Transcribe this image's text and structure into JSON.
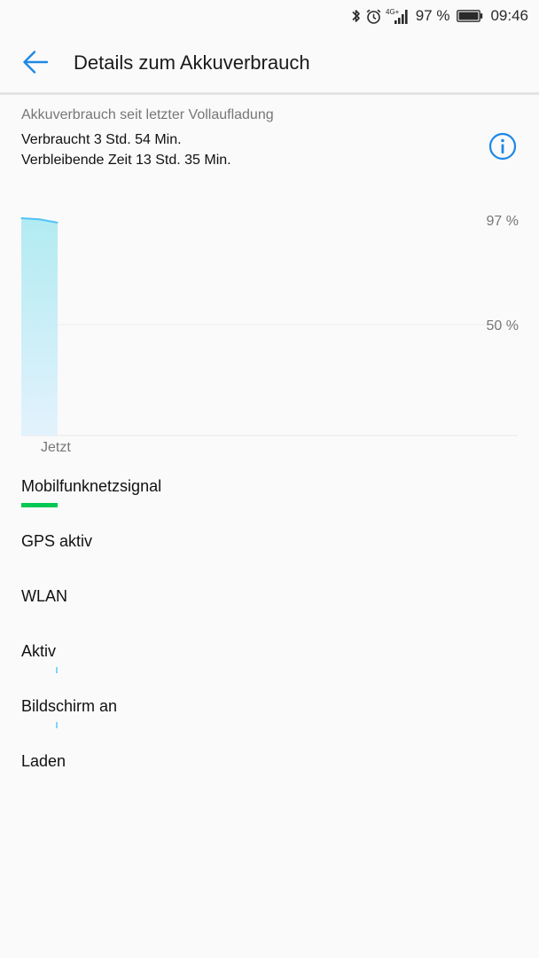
{
  "status_bar": {
    "network_label": "4G+",
    "battery_percent": "97 %",
    "time": "09:46",
    "icons": [
      "bluetooth-icon",
      "alarm-icon",
      "signal-icon",
      "battery-icon"
    ]
  },
  "app_bar": {
    "title": "Details zum Akkuverbrauch",
    "back_icon": "arrow-left-icon"
  },
  "summary": {
    "caption": "Akkuverbrauch seit letzter Vollaufladung",
    "used": "Verbraucht 3 Std. 54 Min.",
    "remaining": "Verbleibende Zeit 13 Std. 35 Min.",
    "info_icon": "info-icon"
  },
  "colors": {
    "accent": "#1e88e5",
    "chart_line": "#4fc3f7",
    "chart_fill_top": "#b2ebf2",
    "chart_fill_bottom": "#e3f2fd",
    "mobile_signal_bar": "#00c853",
    "activity_tick": "#81d4fa"
  },
  "chart_data": {
    "type": "area",
    "series": [
      {
        "name": "",
        "values": [
          98,
          97.5,
          96
        ]
      }
    ],
    "x_axis_label": "Jetzt",
    "y_ticks": [
      "97 %",
      "50 %"
    ],
    "ylim": [
      0,
      100
    ],
    "grid": true
  },
  "usage": {
    "items": [
      {
        "label": "Mobilfunknetzsignal",
        "bar": "solid"
      },
      {
        "label": "GPS aktiv",
        "bar": "none"
      },
      {
        "label": "WLAN",
        "bar": "none"
      },
      {
        "label": "Aktiv",
        "bar": "tick"
      },
      {
        "label": "Bildschirm an",
        "bar": "tick"
      },
      {
        "label": "Laden",
        "bar": "none"
      }
    ]
  }
}
